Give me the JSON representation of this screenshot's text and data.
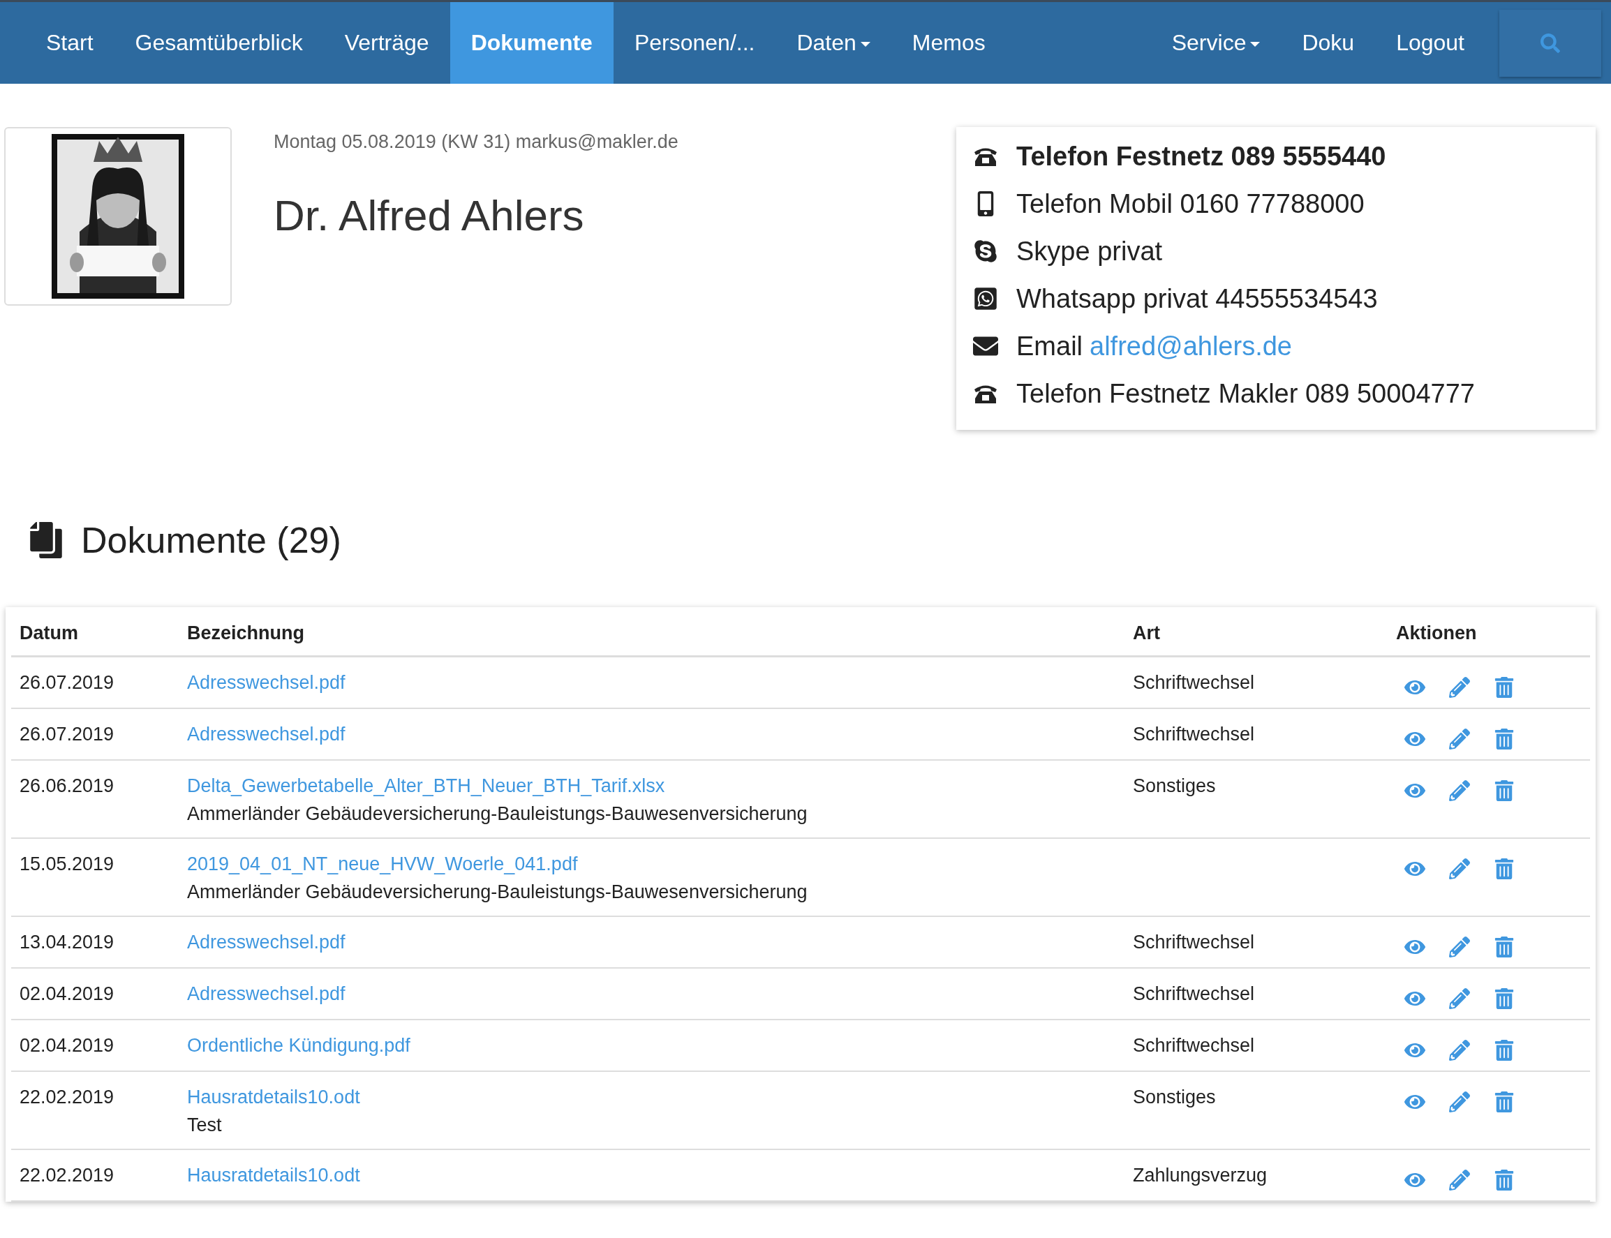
{
  "nav": {
    "left": [
      {
        "label": "Start",
        "dropdown": false,
        "selected": false
      },
      {
        "label": "Gesamtüberblick",
        "dropdown": false,
        "selected": false
      },
      {
        "label": "Verträge",
        "dropdown": false,
        "selected": false
      },
      {
        "label": "Dokumente",
        "dropdown": false,
        "selected": true
      },
      {
        "label": "Personen/...",
        "dropdown": false,
        "selected": false
      },
      {
        "label": "Daten",
        "dropdown": true,
        "selected": false
      },
      {
        "label": "Memos",
        "dropdown": false,
        "selected": false
      }
    ],
    "right": [
      {
        "label": "Service",
        "dropdown": true,
        "selected": false
      },
      {
        "label": "Doku",
        "dropdown": false,
        "selected": false
      },
      {
        "label": "Logout",
        "dropdown": false,
        "selected": false
      }
    ]
  },
  "header": {
    "meta": "Montag 05.08.2019 (KW 31) markus@makler.de",
    "name": "Dr. Alfred Ahlers"
  },
  "contacts": [
    {
      "kind": "phone",
      "text": "Telefon Festnetz 089 5555440",
      "bold": true
    },
    {
      "kind": "mobile",
      "text": "Telefon Mobil 0160 77788000",
      "bold": false
    },
    {
      "kind": "skype",
      "text": "Skype privat",
      "bold": false
    },
    {
      "kind": "whatsapp",
      "text": "Whatsapp privat 44555534543",
      "bold": false
    },
    {
      "kind": "email",
      "text": "Email",
      "link": "alfred@ahlers.de",
      "bold": false
    },
    {
      "kind": "phone",
      "text": "Telefon Festnetz Makler 089 50004777",
      "bold": false
    }
  ],
  "documents": {
    "title": "Dokumente (29)",
    "columns": [
      "Datum",
      "Bezeichnung",
      "Art",
      "Aktionen"
    ],
    "rows": [
      {
        "date": "26.07.2019",
        "file": "Adresswechsel.pdf",
        "art": "Schriftwechsel"
      },
      {
        "date": "26.07.2019",
        "file": "Adresswechsel.pdf",
        "art": "Schriftwechsel"
      },
      {
        "date": "26.06.2019",
        "file": "Delta_Gewerbetabelle_Alter_BTH_Neuer_BTH_Tarif.xlsx",
        "description": "Ammerländer Gebäudeversicherung-Bauleistungs-Bauwesenversicherung",
        "art": "Sonstiges"
      },
      {
        "date": "15.05.2019",
        "file": "2019_04_01_NT_neue_HVW_Woerle_041.pdf",
        "description": "Ammerländer Gebäudeversicherung-Bauleistungs-Bauwesenversicherung"
      },
      {
        "date": "13.04.2019",
        "file": "Adresswechsel.pdf",
        "art": "Schriftwechsel"
      },
      {
        "date": "02.04.2019",
        "file": "Adresswechsel.pdf",
        "art": "Schriftwechsel"
      },
      {
        "date": "02.04.2019",
        "file": "Ordentliche Kündigung.pdf",
        "art": "Schriftwechsel"
      },
      {
        "date": "22.02.2019",
        "file": "Hausratdetails10.odt",
        "description": "Test",
        "art": "Sonstiges"
      },
      {
        "date": "22.02.2019",
        "file": "Hausratdetails10.odt",
        "art": "Zahlungsverzug"
      }
    ]
  }
}
